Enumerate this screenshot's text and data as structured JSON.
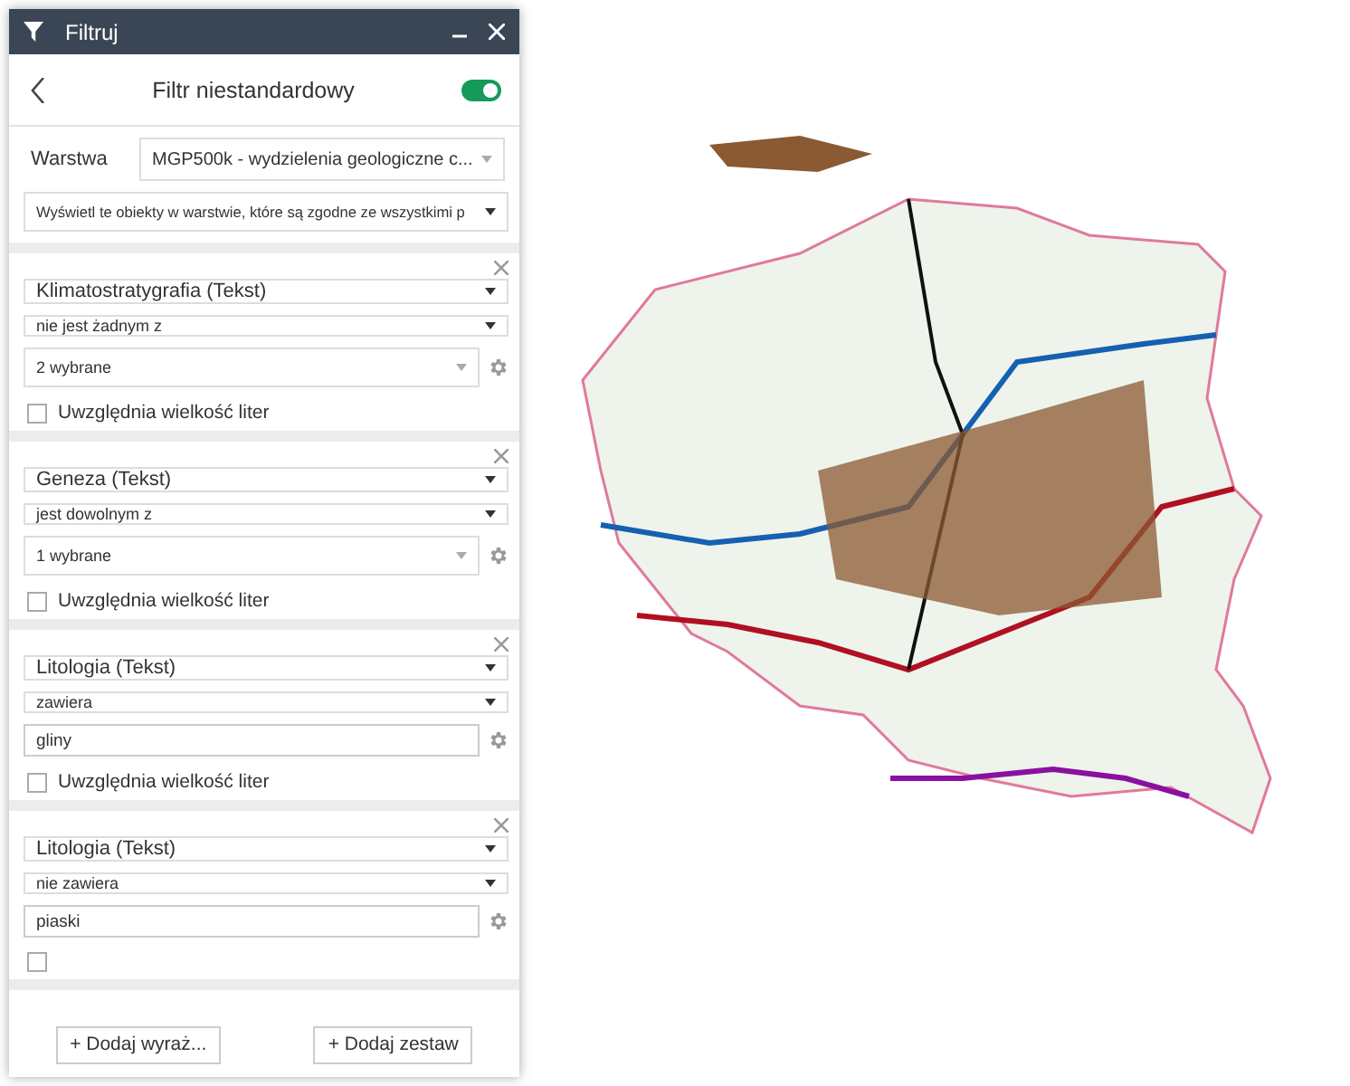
{
  "window": {
    "title": "Filtruj"
  },
  "header": {
    "title": "Filtr niestandardowy",
    "enabled": true
  },
  "layer": {
    "label": "Warstwa",
    "value": "MGP500k - wydzielenia geologiczne c..."
  },
  "mode": {
    "value": "Wyświetl te obiekty w warstwie, które są zgodne ze wszystkimi p"
  },
  "clauses": [
    {
      "field": "Klimatostratygrafia (Tekst)",
      "operator": "nie jest żadnym z",
      "value": "2 wybrane",
      "kind": "select",
      "case_sensitive": false,
      "case_label": "Uwzględnia wielkość liter"
    },
    {
      "field": "Geneza (Tekst)",
      "operator": "jest dowolnym z",
      "value": "1 wybrane",
      "kind": "select",
      "case_sensitive": false,
      "case_label": "Uwzględnia wielkość liter"
    },
    {
      "field": "Litologia (Tekst)",
      "operator": "zawiera",
      "value": "gliny",
      "kind": "text",
      "case_sensitive": false,
      "case_label": "Uwzględnia wielkość liter"
    },
    {
      "field": "Litologia (Tekst)",
      "operator": "nie zawiera",
      "value": "piaski",
      "kind": "text",
      "case_sensitive": false
    }
  ],
  "buttons": [
    "+ Dodaj wyraż...",
    "+ Dodaj zestaw"
  ]
}
